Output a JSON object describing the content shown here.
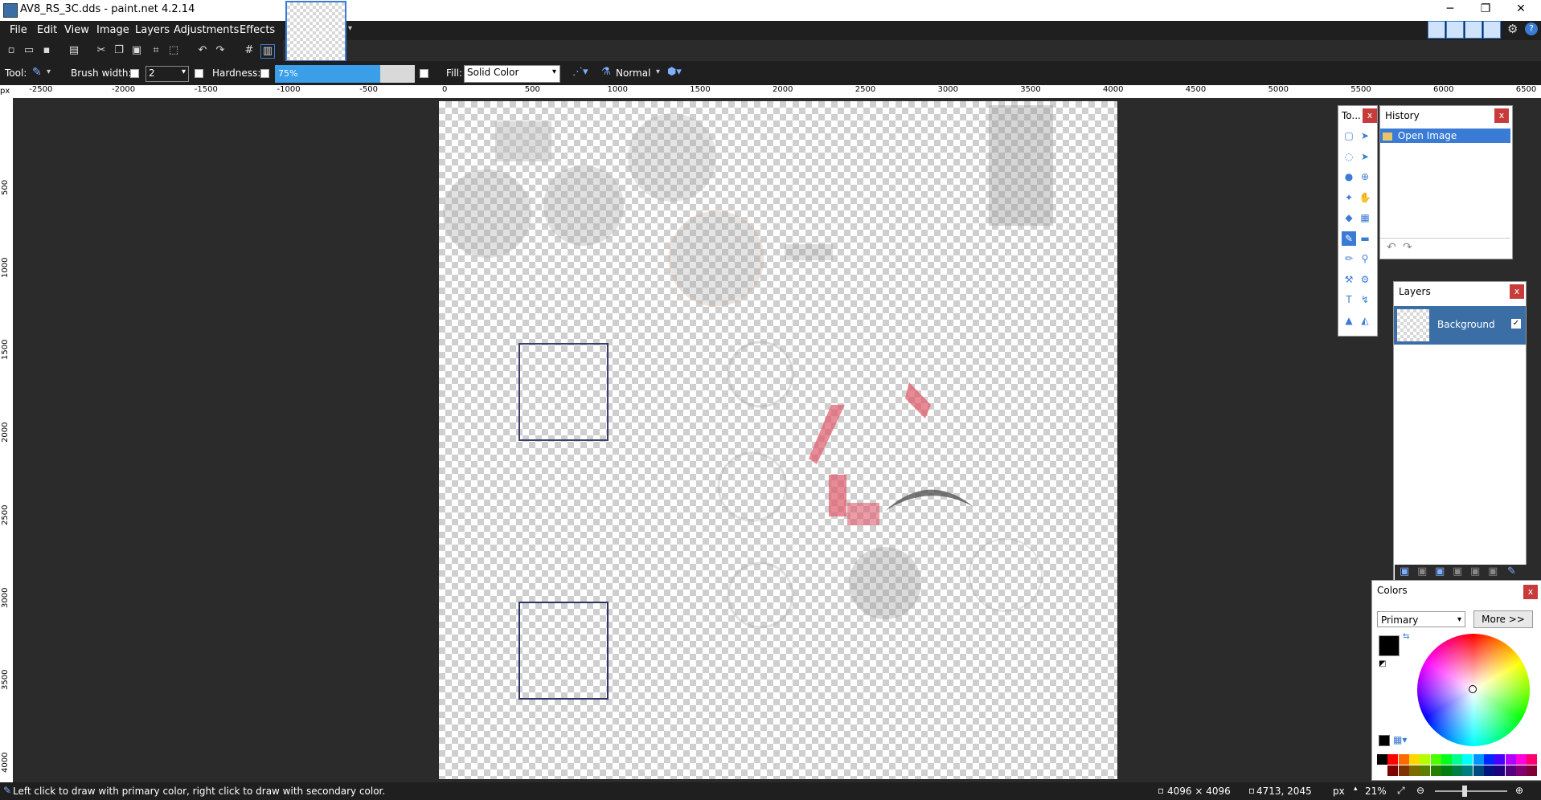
{
  "window": {
    "title": "AV8_RS_3C.dds - paint.net 4.2.14",
    "controls": [
      "─",
      "❐",
      "✕"
    ]
  },
  "menu": [
    "File",
    "Edit",
    "View",
    "Image",
    "Layers",
    "Adjustments",
    "Effects"
  ],
  "toolbar": {
    "tool_label": "Tool:",
    "brush_width_label": "Brush width:",
    "brush_width_value": "2",
    "hardness_label": "Hardness:",
    "hardness_value": "75%",
    "hardness_fraction": 0.75,
    "fill_label": "Fill:",
    "fill_value": "Solid Color",
    "blend_mode": "Normal"
  },
  "ruler": {
    "unit_label": "px",
    "h_ticks": [
      "-2500",
      "-2000",
      "-1500",
      "-1000",
      "-500",
      "0",
      "500",
      "1000",
      "1500",
      "2000",
      "2500",
      "3000",
      "3500",
      "4000",
      "4500",
      "5000",
      "5500",
      "6000",
      "6500"
    ],
    "v_ticks": [
      "500",
      "1000",
      "1500",
      "2000",
      "2500",
      "3000",
      "3500",
      "4000"
    ]
  },
  "tools_panel": {
    "title": "To..."
  },
  "history_panel": {
    "title": "History",
    "items": [
      "Open Image"
    ]
  },
  "layers_panel": {
    "title": "Layers",
    "layers": [
      {
        "name": "Background",
        "visible": true
      }
    ]
  },
  "colors_panel": {
    "title": "Colors",
    "mode": "Primary",
    "more_button": "More >>",
    "primary_color": "#000000",
    "secondary_color": "#ffffff"
  },
  "status": {
    "hint": "Left click to draw with primary color, right click to draw with secondary color.",
    "image_size": "4096 × 4096",
    "cursor_pos": "4713, 2045",
    "unit": "px",
    "zoom": "21%"
  },
  "accent_color": "#3a7bd5"
}
